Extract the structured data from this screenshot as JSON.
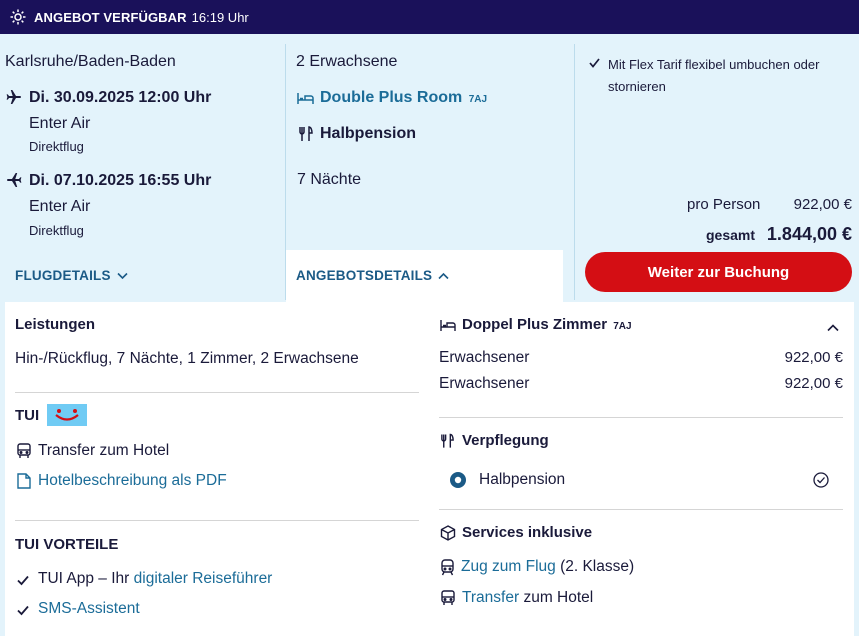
{
  "topbar": {
    "status": "ANGEBOT VERFÜGBAR",
    "time": "16:19 Uhr"
  },
  "flight": {
    "departure_airport": "Karlsruhe/Baden-Baden",
    "outbound": {
      "datetime": "Di. 30.09.2025 12:00 Uhr",
      "airline": "Enter Air",
      "type": "Direktflug"
    },
    "inbound": {
      "datetime": "Di. 07.10.2025 16:55 Uhr",
      "airline": "Enter Air",
      "type": "Direktflug"
    },
    "details_link": "FLUGDETAILS"
  },
  "offer": {
    "travelers": "2 Erwachsene",
    "room_name": "Double Plus Room",
    "room_code": "7AJ",
    "board": "Halbpension",
    "nights": "7 Nächte",
    "details_link": "ANGEBOTSDETAILS"
  },
  "price": {
    "flex_note": "Mit Flex Tarif flexibel umbuchen oder stornieren",
    "per_person_label": "pro Person",
    "per_person_value": "922,00 €",
    "total_label": "gesamt",
    "total_value": "1.844,00 €",
    "book_button": "Weiter zur Buchung"
  },
  "details": {
    "leistungen_title": "Leistungen",
    "leistungen_text": "Hin-/Rückflug, 7 Nächte, 1 Zimmer, 2 Erwachsene",
    "tui_title": "TUI",
    "transfer_item": "Transfer zum Hotel",
    "pdf_link": "Hotelbeschreibung als PDF",
    "vorteile_title": "TUI VORTEILE",
    "vorteile_1_prefix": "TUI App – Ihr",
    "vorteile_1_link": "digitaler Reiseführer",
    "vorteile_2_link": "SMS-Assistent",
    "room_title": "Doppel Plus Zimmer",
    "room_code": "7AJ",
    "guests": [
      {
        "label": "Erwachsener",
        "price": "922,00 €"
      },
      {
        "label": "Erwachsener",
        "price": "922,00 €"
      }
    ],
    "verpflegung_title": "Verpflegung",
    "verpflegung_option": "Halbpension",
    "services_title": "Services inklusive",
    "service_1_link": "Zug zum Flug",
    "service_1_suffix": "(2. Klasse)",
    "service_2_link": "Transfer",
    "service_2_suffix": "zum Hotel"
  },
  "colors": {
    "navy": "#1a115a",
    "red": "#d40e14",
    "light_blue": "#e3f3fb",
    "link": "#1b6c98",
    "tui_logo": "#70cbf4"
  }
}
